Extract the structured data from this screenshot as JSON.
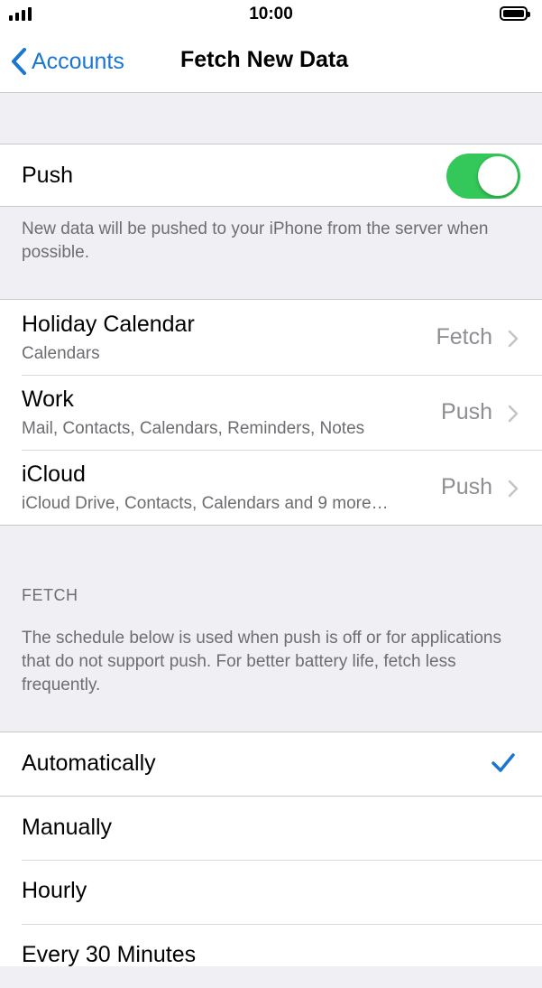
{
  "status_bar": {
    "time": "10:00"
  },
  "nav": {
    "back_label": "Accounts",
    "title": "Fetch New Data"
  },
  "push": {
    "label": "Push",
    "enabled": true,
    "footer": "New data will be pushed to your iPhone from the server when possible."
  },
  "accounts": [
    {
      "name": "Holiday Calendar",
      "services": "Calendars",
      "mode": "Fetch"
    },
    {
      "name": "Work",
      "services": "Mail, Contacts, Calendars, Reminders, Notes",
      "mode": "Push"
    },
    {
      "name": "iCloud",
      "services": "iCloud Drive, Contacts, Calendars and 9 more…",
      "mode": "Push"
    }
  ],
  "fetch": {
    "header": "FETCH",
    "description": "The schedule below is used when push is off or for applications that do not support push. For better battery life, fetch less frequently.",
    "options": [
      {
        "label": "Automatically",
        "selected": true
      },
      {
        "label": "Manually",
        "selected": false
      },
      {
        "label": "Hourly",
        "selected": false
      },
      {
        "label": "Every 30 Minutes",
        "selected": false
      }
    ]
  },
  "colors": {
    "accent": "#1976d2",
    "toggle_on": "#34c759",
    "group_bg": "#efeff4"
  }
}
